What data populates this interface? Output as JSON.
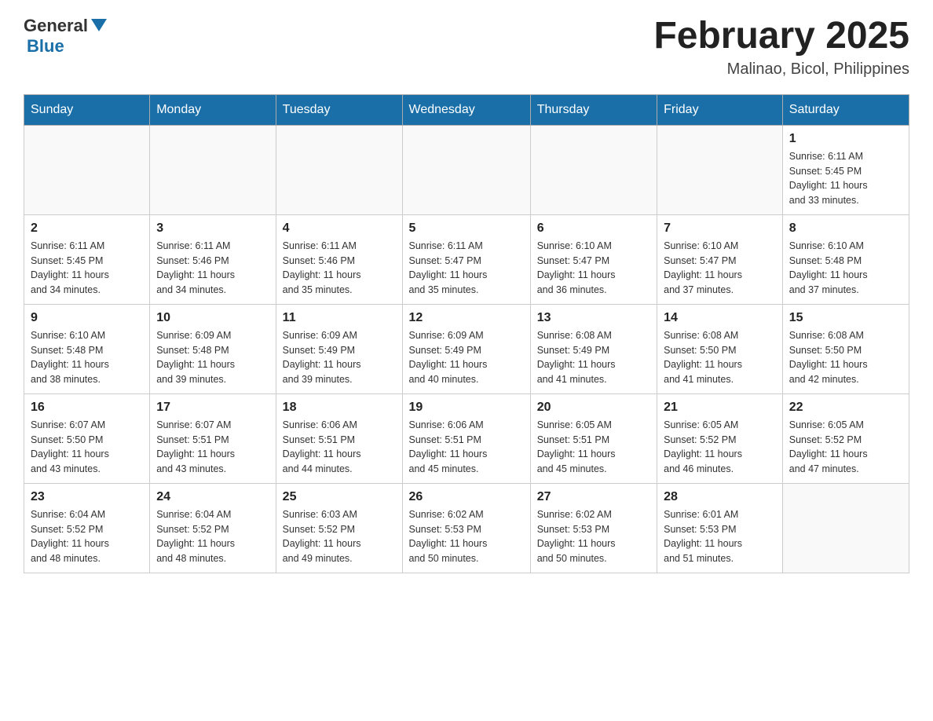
{
  "header": {
    "title": "February 2025",
    "subtitle": "Malinao, Bicol, Philippines"
  },
  "logo": {
    "general": "General",
    "blue": "Blue"
  },
  "days_of_week": [
    "Sunday",
    "Monday",
    "Tuesday",
    "Wednesday",
    "Thursday",
    "Friday",
    "Saturday"
  ],
  "weeks": [
    [
      {
        "day": "",
        "info": ""
      },
      {
        "day": "",
        "info": ""
      },
      {
        "day": "",
        "info": ""
      },
      {
        "day": "",
        "info": ""
      },
      {
        "day": "",
        "info": ""
      },
      {
        "day": "",
        "info": ""
      },
      {
        "day": "1",
        "info": "Sunrise: 6:11 AM\nSunset: 5:45 PM\nDaylight: 11 hours\nand 33 minutes."
      }
    ],
    [
      {
        "day": "2",
        "info": "Sunrise: 6:11 AM\nSunset: 5:45 PM\nDaylight: 11 hours\nand 34 minutes."
      },
      {
        "day": "3",
        "info": "Sunrise: 6:11 AM\nSunset: 5:46 PM\nDaylight: 11 hours\nand 34 minutes."
      },
      {
        "day": "4",
        "info": "Sunrise: 6:11 AM\nSunset: 5:46 PM\nDaylight: 11 hours\nand 35 minutes."
      },
      {
        "day": "5",
        "info": "Sunrise: 6:11 AM\nSunset: 5:47 PM\nDaylight: 11 hours\nand 35 minutes."
      },
      {
        "day": "6",
        "info": "Sunrise: 6:10 AM\nSunset: 5:47 PM\nDaylight: 11 hours\nand 36 minutes."
      },
      {
        "day": "7",
        "info": "Sunrise: 6:10 AM\nSunset: 5:47 PM\nDaylight: 11 hours\nand 37 minutes."
      },
      {
        "day": "8",
        "info": "Sunrise: 6:10 AM\nSunset: 5:48 PM\nDaylight: 11 hours\nand 37 minutes."
      }
    ],
    [
      {
        "day": "9",
        "info": "Sunrise: 6:10 AM\nSunset: 5:48 PM\nDaylight: 11 hours\nand 38 minutes."
      },
      {
        "day": "10",
        "info": "Sunrise: 6:09 AM\nSunset: 5:48 PM\nDaylight: 11 hours\nand 39 minutes."
      },
      {
        "day": "11",
        "info": "Sunrise: 6:09 AM\nSunset: 5:49 PM\nDaylight: 11 hours\nand 39 minutes."
      },
      {
        "day": "12",
        "info": "Sunrise: 6:09 AM\nSunset: 5:49 PM\nDaylight: 11 hours\nand 40 minutes."
      },
      {
        "day": "13",
        "info": "Sunrise: 6:08 AM\nSunset: 5:49 PM\nDaylight: 11 hours\nand 41 minutes."
      },
      {
        "day": "14",
        "info": "Sunrise: 6:08 AM\nSunset: 5:50 PM\nDaylight: 11 hours\nand 41 minutes."
      },
      {
        "day": "15",
        "info": "Sunrise: 6:08 AM\nSunset: 5:50 PM\nDaylight: 11 hours\nand 42 minutes."
      }
    ],
    [
      {
        "day": "16",
        "info": "Sunrise: 6:07 AM\nSunset: 5:50 PM\nDaylight: 11 hours\nand 43 minutes."
      },
      {
        "day": "17",
        "info": "Sunrise: 6:07 AM\nSunset: 5:51 PM\nDaylight: 11 hours\nand 43 minutes."
      },
      {
        "day": "18",
        "info": "Sunrise: 6:06 AM\nSunset: 5:51 PM\nDaylight: 11 hours\nand 44 minutes."
      },
      {
        "day": "19",
        "info": "Sunrise: 6:06 AM\nSunset: 5:51 PM\nDaylight: 11 hours\nand 45 minutes."
      },
      {
        "day": "20",
        "info": "Sunrise: 6:05 AM\nSunset: 5:51 PM\nDaylight: 11 hours\nand 45 minutes."
      },
      {
        "day": "21",
        "info": "Sunrise: 6:05 AM\nSunset: 5:52 PM\nDaylight: 11 hours\nand 46 minutes."
      },
      {
        "day": "22",
        "info": "Sunrise: 6:05 AM\nSunset: 5:52 PM\nDaylight: 11 hours\nand 47 minutes."
      }
    ],
    [
      {
        "day": "23",
        "info": "Sunrise: 6:04 AM\nSunset: 5:52 PM\nDaylight: 11 hours\nand 48 minutes."
      },
      {
        "day": "24",
        "info": "Sunrise: 6:04 AM\nSunset: 5:52 PM\nDaylight: 11 hours\nand 48 minutes."
      },
      {
        "day": "25",
        "info": "Sunrise: 6:03 AM\nSunset: 5:52 PM\nDaylight: 11 hours\nand 49 minutes."
      },
      {
        "day": "26",
        "info": "Sunrise: 6:02 AM\nSunset: 5:53 PM\nDaylight: 11 hours\nand 50 minutes."
      },
      {
        "day": "27",
        "info": "Sunrise: 6:02 AM\nSunset: 5:53 PM\nDaylight: 11 hours\nand 50 minutes."
      },
      {
        "day": "28",
        "info": "Sunrise: 6:01 AM\nSunset: 5:53 PM\nDaylight: 11 hours\nand 51 minutes."
      },
      {
        "day": "",
        "info": ""
      }
    ]
  ]
}
